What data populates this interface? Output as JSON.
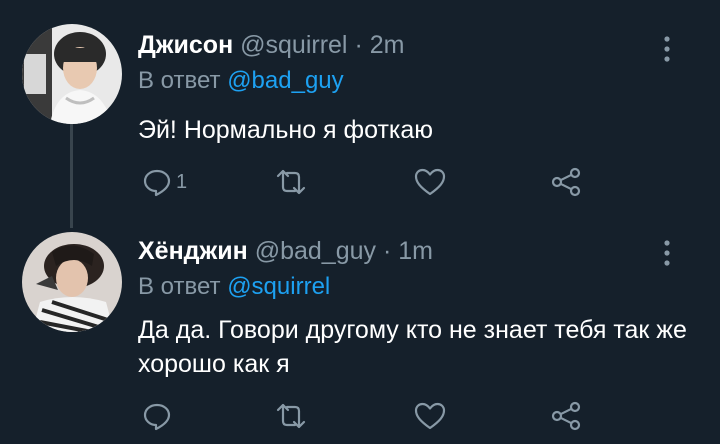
{
  "tweets": [
    {
      "name": "Джисон",
      "handle": "@squirrel",
      "time": "2m",
      "reply_prefix": "В ответ",
      "reply_to": "@bad_guy",
      "text": "Эй! Нормально я фоткаю",
      "reply_count": "1"
    },
    {
      "name": "Хёнджин",
      "handle": "@bad_guy",
      "time": "1m",
      "reply_prefix": "В ответ",
      "reply_to": "@squirrel",
      "text": "Да да. Говори другому кто не знает тебя так же хорошо как я",
      "reply_count": ""
    }
  ],
  "icons": [
    "reply-icon",
    "retweet-icon",
    "like-icon",
    "share-icon",
    "more-icon"
  ],
  "colors": {
    "background": "#15202b",
    "accent": "#1da1f2",
    "muted": "#8899a6",
    "thread_line": "#38444d"
  }
}
